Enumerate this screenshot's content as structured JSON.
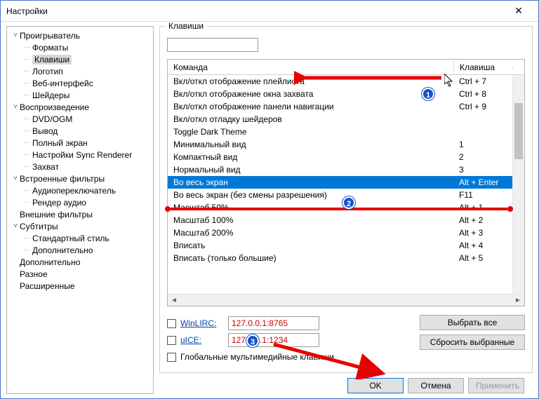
{
  "window": {
    "title": "Настройки"
  },
  "tree": [
    {
      "label": "Проигрыватель",
      "expanded": true,
      "children": [
        {
          "label": "Форматы"
        },
        {
          "label": "Клавиши",
          "selected": true
        },
        {
          "label": "Логотип"
        },
        {
          "label": "Веб-интерфейс"
        },
        {
          "label": "Шейдеры"
        }
      ]
    },
    {
      "label": "Воспроизведение",
      "expanded": true,
      "children": [
        {
          "label": "DVD/OGM"
        },
        {
          "label": "Вывод"
        },
        {
          "label": "Полный экран"
        },
        {
          "label": "Настройки Sync Renderer"
        },
        {
          "label": "Захват"
        }
      ]
    },
    {
      "label": "Встроенные фильтры",
      "expanded": true,
      "children": [
        {
          "label": "Аудиопереключатель"
        },
        {
          "label": "Рендер аудио"
        }
      ]
    },
    {
      "label": "Внешние фильтры",
      "expanded": false
    },
    {
      "label": "Субтитры",
      "expanded": true,
      "children": [
        {
          "label": "Стандартный стиль"
        },
        {
          "label": "Дополнительно"
        }
      ]
    },
    {
      "label": "Дополнительно",
      "expanded": false
    },
    {
      "label": "Разное",
      "expanded": false
    },
    {
      "label": "Расширенные",
      "expanded": false
    }
  ],
  "panel": {
    "title": "Клавиши",
    "filter": "",
    "columns": {
      "command": "Команда",
      "key": "Клавиша"
    },
    "rows": [
      {
        "cmd": "Вкл/откл отображение плейлиста",
        "key": "Ctrl + 7"
      },
      {
        "cmd": "Вкл/откл отображение окна захвата",
        "key": "Ctrl + 8"
      },
      {
        "cmd": "Вкл/откл отображение панели навигации",
        "key": "Ctrl + 9"
      },
      {
        "cmd": "Вкл/откл отладку шейдеров",
        "key": ""
      },
      {
        "cmd": "Toggle Dark Theme",
        "key": ""
      },
      {
        "cmd": "Минимальный вид",
        "key": "1"
      },
      {
        "cmd": "Компактный вид",
        "key": "2"
      },
      {
        "cmd": "Нормальный вид",
        "key": "3"
      },
      {
        "cmd": "Во весь экран",
        "key": "Alt + Enter",
        "selected": true
      },
      {
        "cmd": "Во весь экран (без смены разрешения)",
        "key": "F11"
      },
      {
        "cmd": "Масштаб 50%",
        "key": "Alt + 1"
      },
      {
        "cmd": "Масштаб 100%",
        "key": "Alt + 2"
      },
      {
        "cmd": "Масштаб 200%",
        "key": "Alt + 3"
      },
      {
        "cmd": "Вписать",
        "key": "Alt + 4"
      },
      {
        "cmd": "Вписать (только большие)",
        "key": "Alt + 5"
      }
    ],
    "winlirc": {
      "label": "WinLIRC:",
      "value": "127.0.0.1:8765"
    },
    "uice": {
      "label": "uICE:",
      "value": "127.0.0.1:1234"
    },
    "global_media_keys": "Глобальные мультимедийные клавиши",
    "select_all": "Выбрать все",
    "reset_selected": "Сбросить выбранные"
  },
  "footer": {
    "ok": "OK",
    "cancel": "Отмена",
    "apply": "Применить"
  }
}
